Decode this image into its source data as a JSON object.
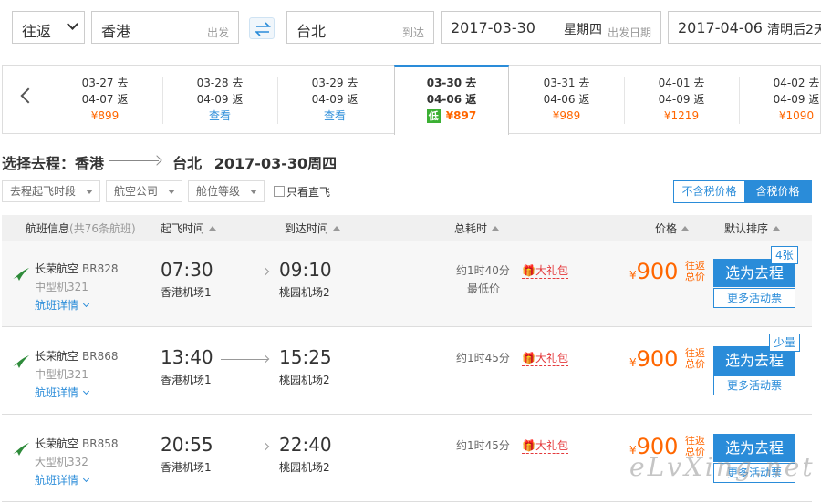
{
  "search": {
    "trip_type": "往返",
    "from_city": "香港",
    "from_label": "出发",
    "to_city": "台北",
    "to_label": "到达",
    "depart_date": "2017-03-30",
    "depart_weekday": "星期四",
    "depart_label": "出发日期",
    "return_date": "2017-04-06",
    "return_note": "清明后2天"
  },
  "date_strip": [
    {
      "go": "03-27 去",
      "back": "04-07 返",
      "price": "¥899"
    },
    {
      "go": "03-28 去",
      "back": "04-09 返",
      "price": "查看"
    },
    {
      "go": "03-29 去",
      "back": "04-09 返",
      "price": "查看"
    },
    {
      "go": "03-30 去",
      "back": "04-06 返",
      "price": "¥897",
      "badge": "低"
    },
    {
      "go": "03-31 去",
      "back": "04-06 返",
      "price": "¥989"
    },
    {
      "go": "04-01 去",
      "back": "04-09 返",
      "price": "¥1219"
    },
    {
      "go": "04-02 去",
      "back": "04-09 返",
      "price": "¥1090"
    }
  ],
  "route": {
    "prefix": "选择去程：香港",
    "dest": "台北",
    "date": "2017-03-30周四"
  },
  "filters": {
    "depart_time": "去程起飞时段",
    "airline": "航空公司",
    "cabin": "舱位等级",
    "direct_only": "只看直飞",
    "excl_tax": "不含税价格",
    "incl_tax": "含税价格"
  },
  "table_header": {
    "flight_info": "航班信息",
    "count": "(共76条航班)",
    "depart": "起飞时间",
    "arrive": "到达时间",
    "duration": "总耗时",
    "price": "价格",
    "sort": "默认排序"
  },
  "flights": [
    {
      "airline": "长荣航空",
      "flight_no": "BR828",
      "plane": "中型机321",
      "detail": "航班详情",
      "dep_time": "07:30",
      "dep_airport": "香港机场1",
      "arr_time": "09:10",
      "arr_airport": "桃园机场2",
      "duration": "约1时40分",
      "note": "最低价",
      "gift": "大礼包",
      "currency": "¥",
      "price": "900",
      "tax_note": "往返总价",
      "select": "选为去程",
      "more": "更多活动票",
      "seats": "4张"
    },
    {
      "airline": "长荣航空",
      "flight_no": "BR868",
      "plane": "中型机321",
      "detail": "航班详情",
      "dep_time": "13:40",
      "dep_airport": "香港机场1",
      "arr_time": "15:25",
      "arr_airport": "桃园机场2",
      "duration": "约1时45分",
      "note": "",
      "gift": "大礼包",
      "currency": "¥",
      "price": "900",
      "tax_note": "往返总价",
      "select": "选为去程",
      "more": "更多活动票",
      "seats": "少量"
    },
    {
      "airline": "长荣航空",
      "flight_no": "BR858",
      "plane": "大型机332",
      "detail": "航班详情",
      "dep_time": "20:55",
      "dep_airport": "香港机场1",
      "arr_time": "22:40",
      "arr_airport": "桃园机场2",
      "duration": "约1时45分",
      "note": "",
      "gift": "大礼包",
      "currency": "¥",
      "price": "900",
      "tax_note": "往返总价",
      "select": "选为去程",
      "more": "更多活动票",
      "seats": ""
    }
  ],
  "watermark": "eLvXing.net",
  "colors": {
    "accent": "#2a8cd9",
    "price": "#ff6600",
    "gift": "#e4393c",
    "low_badge": "#3cb034",
    "airline_logo": "#2e8b3a"
  }
}
